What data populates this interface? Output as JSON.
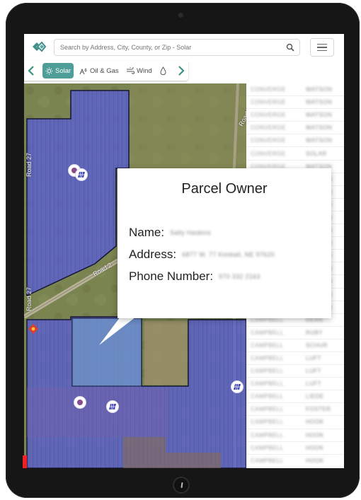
{
  "search": {
    "placeholder": "Search by Address, City, County, or Zip - Solar"
  },
  "tabs": [
    {
      "label": "Solar",
      "icon": "sun-icon",
      "active": true
    },
    {
      "label": "Oil & Gas",
      "icon": "oil-gas-icon",
      "active": false
    },
    {
      "label": "Wind",
      "icon": "wind-icon",
      "active": false
    },
    {
      "label": "",
      "icon": "water-drop-icon",
      "active": false
    }
  ],
  "map": {
    "road_labels": [
      "Road 2",
      "Road 2",
      "Road 27",
      "Road 27"
    ]
  },
  "popup": {
    "title": "Parcel Owner",
    "name_label": "Name:",
    "name_value": "Sally Haskins",
    "address_label": "Address:",
    "address_value": "6877 W. 77 Kimball, NE 97620",
    "phone_label": "Phone Number:",
    "phone_value": "970 332 2163"
  },
  "data_list": [
    [
      "CONVERGE",
      "WATSON"
    ],
    [
      "CONVERGE",
      "WATSON"
    ],
    [
      "CONVERGE",
      "WATSON"
    ],
    [
      "CONVERGE",
      "WATSON"
    ],
    [
      "CONVERGE",
      "WATSON"
    ],
    [
      "CONVERGE",
      "SOLAR"
    ],
    [
      "CONVERGE",
      "WATSON"
    ],
    [
      "CONVERGE",
      "WATSON"
    ],
    [
      "CONVERGE",
      "WATSON"
    ],
    [
      "CONVERGE",
      "WATSON"
    ],
    [
      "CONVERGE",
      "WATSON"
    ],
    [
      "CONVERGE",
      "WATSON"
    ],
    [
      "CONVERGE",
      "WATSON"
    ],
    [
      "CONVERGE",
      "WATSON"
    ],
    [
      "CONVERGE",
      "WATSON"
    ],
    [
      "CONVERGE",
      "WATSON"
    ],
    [
      "CONVERGE",
      "WATSON"
    ],
    [
      "CONVERGE",
      "WATSON"
    ],
    [
      "CAMPBELL",
      "DEAN"
    ],
    [
      "CAMPBELL",
      "RUBY"
    ],
    [
      "CAMPBELL",
      "SCHUR"
    ],
    [
      "CAMPBELL",
      "LUFT"
    ],
    [
      "CAMPBELL",
      "LUFT"
    ],
    [
      "CAMPBELL",
      "LUFT"
    ],
    [
      "CAMPBELL",
      "LIEDE"
    ],
    [
      "CAMPBELL",
      "FOSTER"
    ],
    [
      "CAMPBELL",
      "HOOK"
    ],
    [
      "CAMPBELL",
      "HOOK"
    ],
    [
      "CAMPBELL",
      "HOOK"
    ],
    [
      "CAMPBELL",
      "HOOK"
    ]
  ],
  "colors": {
    "accent": "#4f9d99",
    "parcel_fill": "#5a5fd0",
    "parcel_border": "#1a1a3a"
  }
}
